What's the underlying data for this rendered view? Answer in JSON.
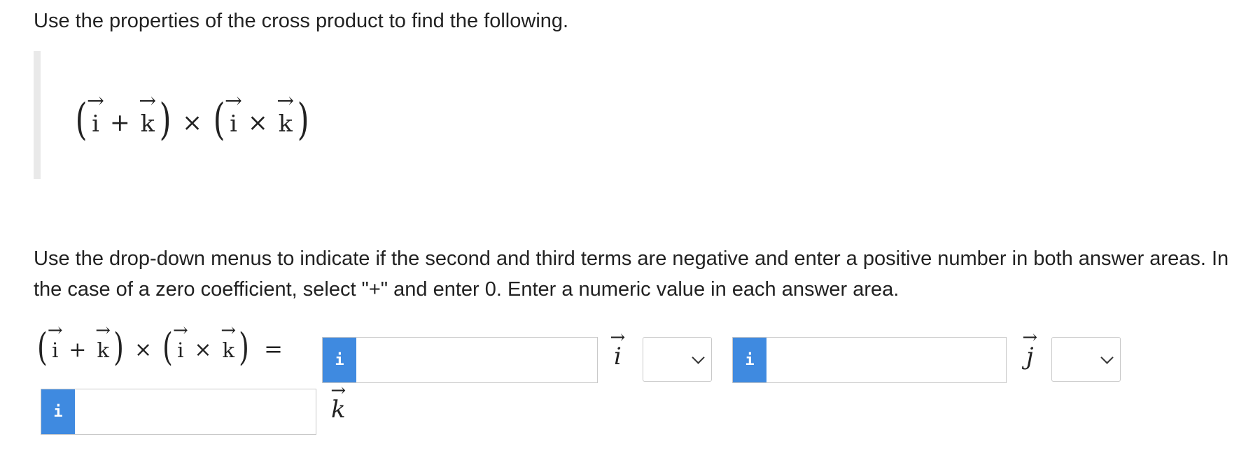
{
  "prompt": "Use the properties of the cross product to find the following.",
  "expression": {
    "open_paren": "(",
    "close_paren": ")",
    "v1": "i",
    "plus": "+",
    "v2": "k",
    "times": "×",
    "v3": "i",
    "cross": "×",
    "v4": "k",
    "arrow": "→",
    "equals": "="
  },
  "instructions": "Use the drop-down menus to indicate if the second and third terms are negative and enter a positive number in both answer areas. In the case of a zero coefficient, select \"+\" and enter 0. Enter a numeric value in each answer area.",
  "answer": {
    "info_label": "i",
    "input1_value": "",
    "unit1": "i",
    "select1_value": "",
    "input2_value": "",
    "unit2": "j",
    "select2_value": "",
    "input3_value": "",
    "unit3": "k"
  }
}
